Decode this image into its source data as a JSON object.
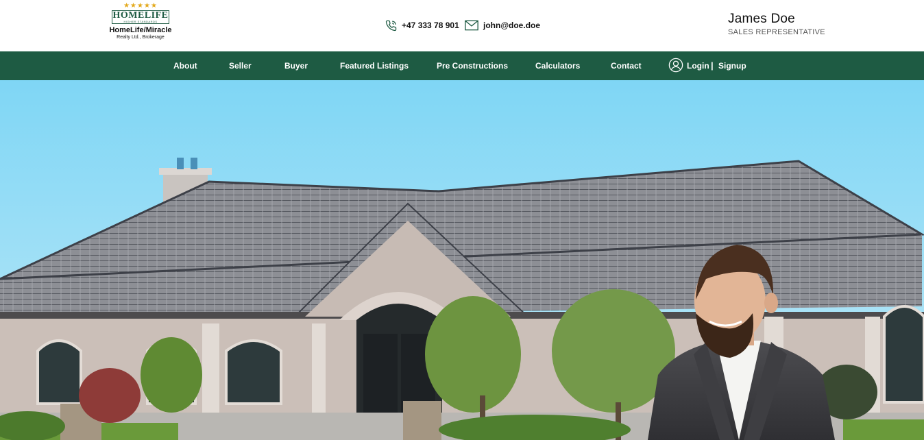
{
  "logo": {
    "stars": "★★★★★",
    "brand": "HOMELIFE",
    "tagline": "HIGHER STANDARDS",
    "name": "HomeLife/Miracle",
    "subtitle": "Realty Ltd., Brokerage"
  },
  "contact": {
    "phone": "+47 333 78 901",
    "phone_icon": "phone-icon",
    "email": "john@doe.doe",
    "email_icon": "mail-icon"
  },
  "agent": {
    "name": "James Doe",
    "title": "SALES REPRESENTATIVE"
  },
  "nav": {
    "items": [
      {
        "label": "About"
      },
      {
        "label": "Seller"
      },
      {
        "label": "Buyer"
      },
      {
        "label": "Featured Listings"
      },
      {
        "label": "Pre Constructions"
      },
      {
        "label": "Calculators"
      },
      {
        "label": "Contact"
      }
    ],
    "user_icon": "user-circle-icon",
    "login": "Login",
    "separator": "|",
    "signup": "Signup"
  },
  "hero": {
    "scene": "house-photo",
    "person": "agent-portrait"
  },
  "colors": {
    "brand_green": "#1e5b43",
    "star_gold": "#e3a91c",
    "sky": "#7fd6f5"
  }
}
